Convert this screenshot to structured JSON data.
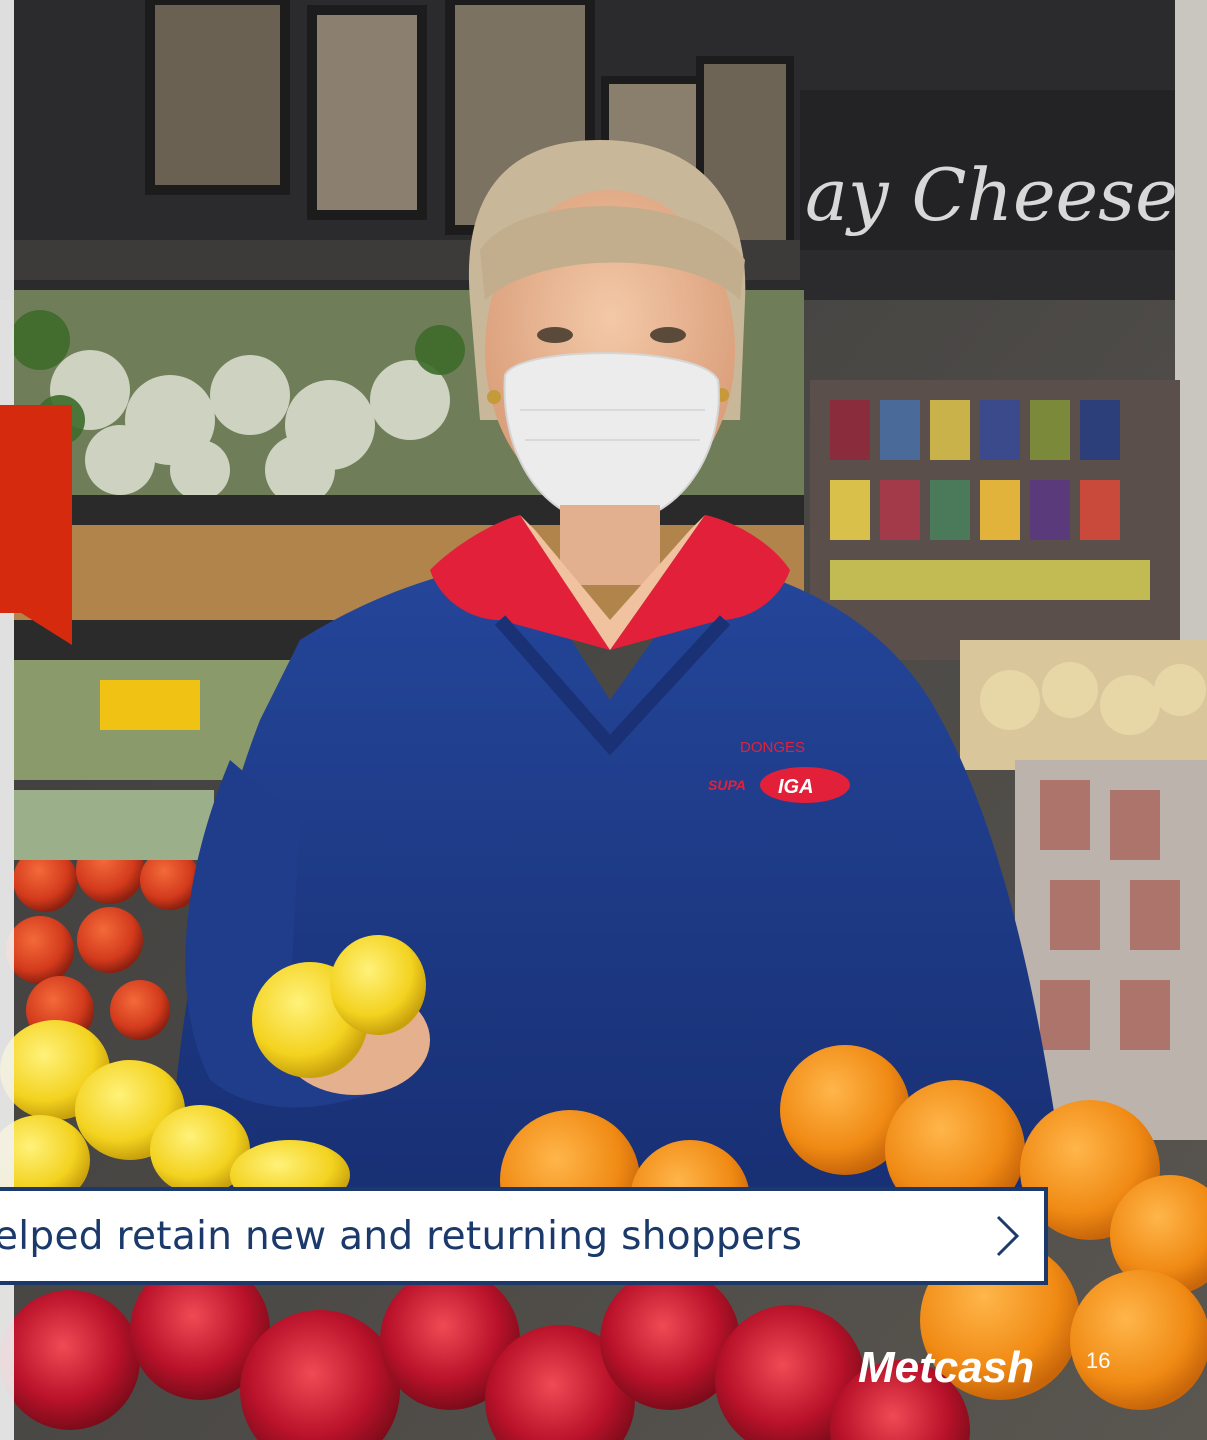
{
  "caption": {
    "text": "elped retain new and returning shoppers",
    "chevron_icon": "chevron-right-icon"
  },
  "photo": {
    "sign_text": "ay Cheese",
    "uniform_text_line1": "DONGES",
    "uniform_text_line2": "SUPA",
    "uniform_badge": "IGA"
  },
  "branding": {
    "logo_text": "Metcash",
    "page_number": "16"
  },
  "colors": {
    "accent_red": "#d62a0e",
    "navy": "#1b3a6b",
    "sweater_blue": "#1f3d8a",
    "collar_red": "#e3203a",
    "lemon": "#f3d21f",
    "orange": "#f08a14",
    "apple_red": "#b9122a"
  }
}
